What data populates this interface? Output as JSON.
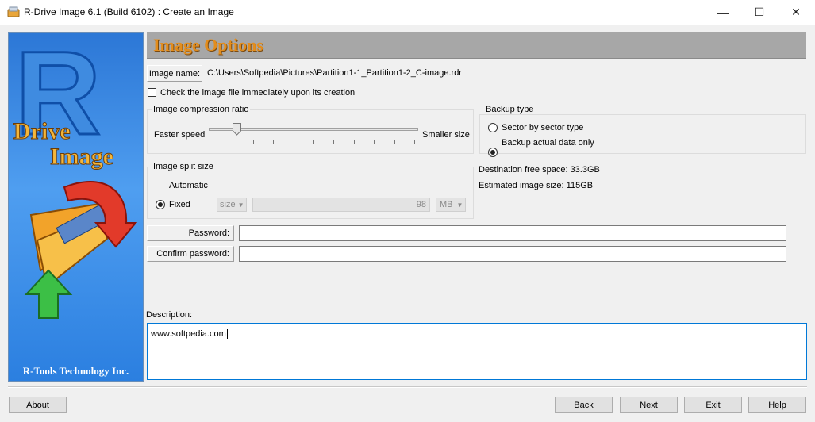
{
  "window": {
    "title": "R-Drive Image 6.1 (Build 6102) : Create an Image",
    "minimize_glyph": "—",
    "maximize_glyph": "☐",
    "close_glyph": "✕"
  },
  "banner": {
    "logo_letter": "R",
    "logo_line1": "Drive",
    "logo_line2": "Image",
    "company": "R-Tools Technology Inc."
  },
  "page": {
    "header_title": "Image Options"
  },
  "image_name": {
    "label": "Image name:",
    "value": "C:\\Users\\Softpedia\\Pictures\\Partition1-1_Partition1-2_C-image.rdr"
  },
  "check_after_creation": {
    "label": "Check the image file immediately upon its creation",
    "checked": false
  },
  "compression": {
    "group_label": "Image compression ratio",
    "left_label": "Faster speed",
    "right_label": "Smaller size",
    "level_fraction": 0.12
  },
  "backup_type": {
    "group_label": "Backup type",
    "options": [
      "Sector by sector type",
      "Backup actual data only"
    ],
    "selected": "Backup actual data only"
  },
  "split": {
    "group_label": "Image split size",
    "automatic_label": "Automatic",
    "fixed_label": "Fixed",
    "size_select": "size",
    "size_value": "98",
    "unit_select": "MB",
    "selected": "Automatic"
  },
  "info": {
    "destination_free_space": "Destination free space: 33.3GB",
    "estimated_image_size": "Estimated image size: 115GB"
  },
  "password": {
    "label": "Password:",
    "value": ""
  },
  "confirm_password": {
    "label": "Confirm password:",
    "value": ""
  },
  "description": {
    "label": "Description:",
    "value": "www.softpedia.com"
  },
  "buttons": {
    "about": "About",
    "back": "Back",
    "next": "Next",
    "exit": "Exit",
    "help": "Help"
  },
  "colors": {
    "header_bg": "#a7a7a7",
    "header_text": "#e38d1d",
    "banner_blue": "#2c77d6",
    "accent_blue": "#0078d7"
  }
}
